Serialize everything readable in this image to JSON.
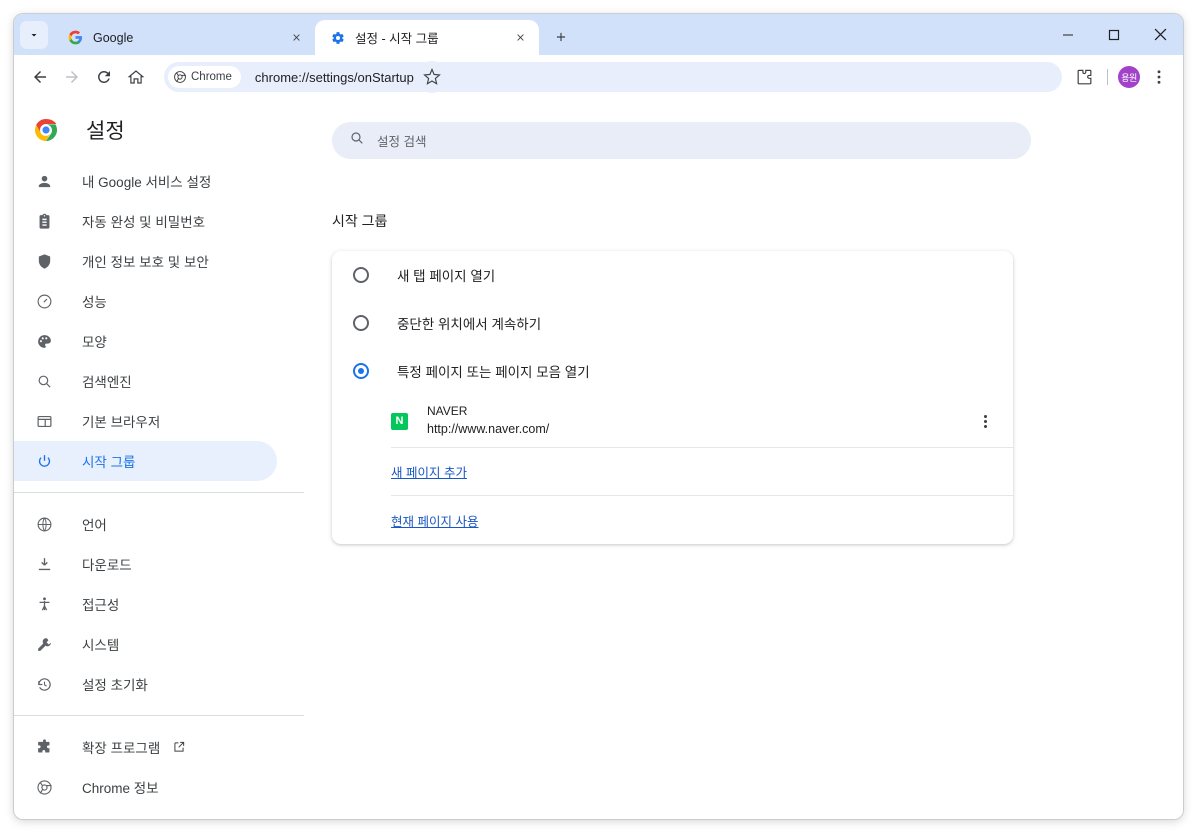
{
  "window": {
    "controls": {
      "minimize": "minimize-icon",
      "maximize": "maximize-icon",
      "close": "close-icon"
    }
  },
  "tabstrip": {
    "tab_search_icon": "chevron-down-icon",
    "new_tab_label": "+",
    "tabs": [
      {
        "title": "Google",
        "favicon": "google-g-icon",
        "active": false
      },
      {
        "title": "설정 - 시작 그룹",
        "favicon": "settings-gear-icon",
        "active": true
      }
    ]
  },
  "toolbar": {
    "back_icon": "back-arrow-icon",
    "forward_icon": "forward-arrow-icon",
    "reload_icon": "reload-icon",
    "home_icon": "home-icon",
    "chip_label": "Chrome",
    "url": "chrome://settings/onStartup",
    "bookmark_icon": "star-icon",
    "extensions_icon": "extensions-puzzle-icon",
    "avatar_initials": "용원",
    "avatar_color": "#a142c8",
    "menu_icon": "three-dot-menu-icon"
  },
  "sidebar": {
    "brand_title": "설정",
    "brand_logo": "chrome-logo-icon",
    "items": [
      {
        "label": "내 Google 서비스 설정",
        "icon": "person-icon",
        "selected": false
      },
      {
        "label": "자동 완성 및 비밀번호",
        "icon": "clipboard-icon",
        "selected": false
      },
      {
        "label": "개인 정보 보호 및 보안",
        "icon": "shield-icon",
        "selected": false
      },
      {
        "label": "성능",
        "icon": "speedometer-icon",
        "selected": false
      },
      {
        "label": "모양",
        "icon": "palette-icon",
        "selected": false
      },
      {
        "label": "검색엔진",
        "icon": "search-icon",
        "selected": false
      },
      {
        "label": "기본 브라우저",
        "icon": "browser-window-icon",
        "selected": false
      },
      {
        "label": "시작 그룹",
        "icon": "power-icon",
        "selected": true
      }
    ],
    "items2": [
      {
        "label": "언어",
        "icon": "globe-icon"
      },
      {
        "label": "다운로드",
        "icon": "download-icon"
      },
      {
        "label": "접근성",
        "icon": "accessibility-icon"
      },
      {
        "label": "시스템",
        "icon": "wrench-icon"
      },
      {
        "label": "설정 초기화",
        "icon": "history-restore-icon"
      }
    ],
    "items3": [
      {
        "label": "확장 프로그램",
        "icon": "puzzle-icon",
        "external": "external-link-icon"
      },
      {
        "label": "Chrome 정보",
        "icon": "chrome-outline-icon",
        "external": ""
      }
    ],
    "selected_accent": "#1a73e8",
    "selected_bg": "#e8f0fe"
  },
  "main": {
    "search": {
      "placeholder": "설정 검색",
      "icon": "search-icon",
      "value": ""
    },
    "section_title": "시작 그룹",
    "startup_options": [
      {
        "label": "새 탭 페이지 열기",
        "checked": false
      },
      {
        "label": "중단한 위치에서 계속하기",
        "checked": false
      },
      {
        "label": "특정 페이지 또는 페이지 모음 열기",
        "checked": true
      }
    ],
    "startup_pages": [
      {
        "name": "NAVER",
        "url": "http://www.naver.com/",
        "favicon_letter": "N",
        "favicon_color": "#03c75a",
        "menu_icon": "three-dot-menu-icon"
      }
    ],
    "add_page_link": "새 페이지 추가",
    "use_current_page_link": "현재 페이지 사용"
  }
}
